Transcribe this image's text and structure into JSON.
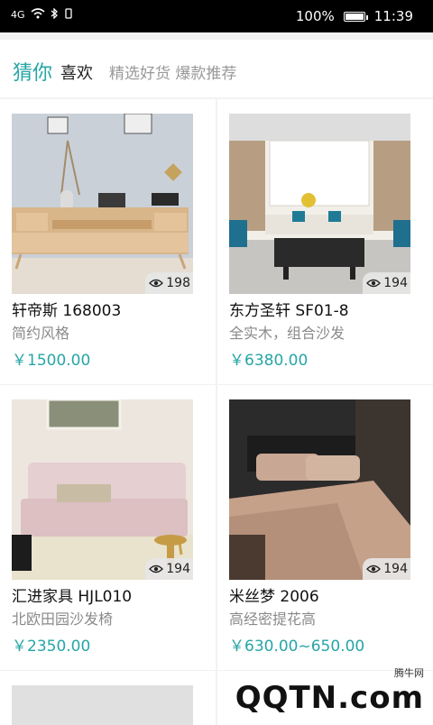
{
  "status": {
    "signal": "4G",
    "battery": "100%",
    "time": "11:39"
  },
  "header": {
    "title_highlight": "猜你",
    "title_rest": "喜欢",
    "subtitle": "精选好货 爆款推荐"
  },
  "products": [
    {
      "name": "轩帝斯  168003",
      "desc": "简约风格",
      "price": "￥1500.00",
      "views": "198",
      "image": "tv-cabinet"
    },
    {
      "name": "东方圣轩  SF01-8",
      "desc": "全实木，组合沙发",
      "price": "￥6380.00",
      "views": "194",
      "image": "living-room"
    },
    {
      "name": "汇进家具  HJL010",
      "desc": "北欧田园沙发椅",
      "price": "￥2350.00",
      "views": "194",
      "image": "pink-sofa"
    },
    {
      "name": "米丝梦  2006",
      "desc": "高经密提花高",
      "price": "￥630.00~650.00",
      "views": "194",
      "image": "bedding"
    }
  ],
  "watermark": {
    "small": "腾牛网",
    "big": "QQTN.com"
  }
}
